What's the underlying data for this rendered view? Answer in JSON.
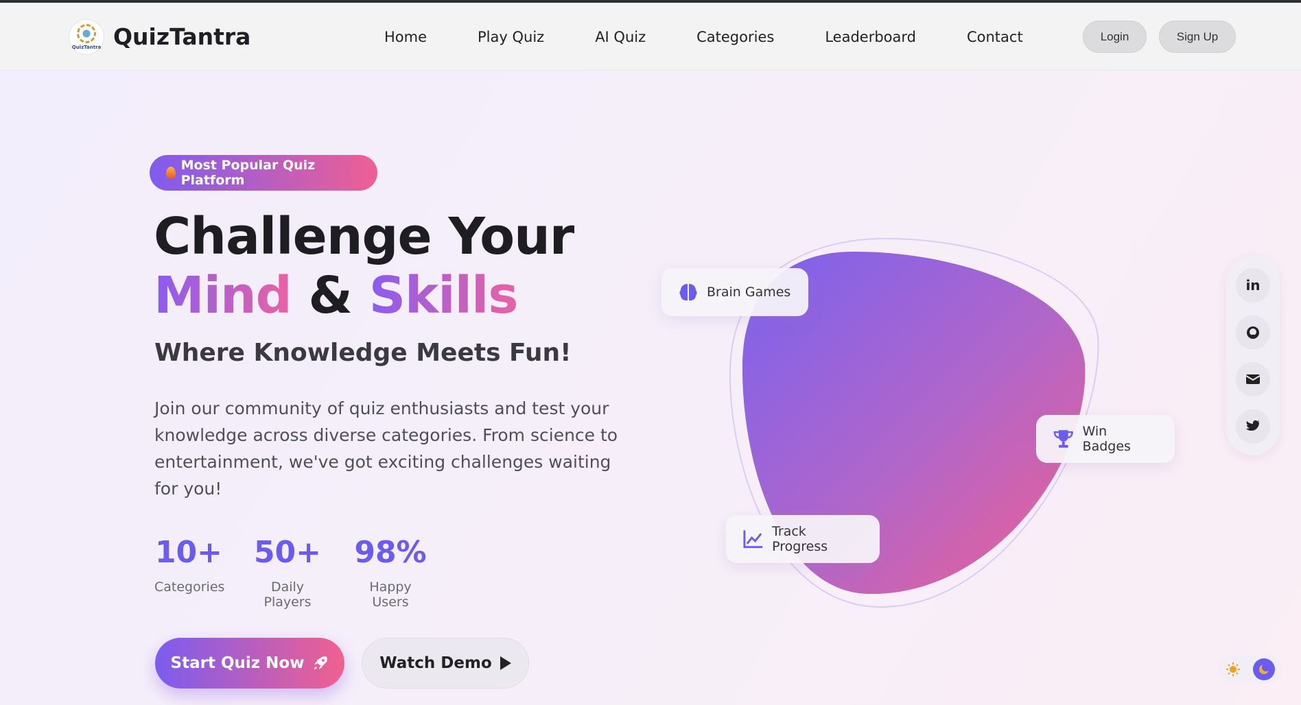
{
  "header": {
    "brand": "QuizTantra",
    "logo_text": "QuizTantra",
    "nav": [
      "Home",
      "Play Quiz",
      "AI Quiz",
      "Categories",
      "Leaderboard",
      "Contact"
    ],
    "login_label": "Login",
    "signup_label": "Sign Up"
  },
  "hero": {
    "badge": "Most Popular Quiz Platform",
    "title_line1": "Challenge Your",
    "title_word1": "Mind",
    "title_amp": "&",
    "title_word2": "Skills",
    "subtitle": "Where Knowledge Meets Fun!",
    "description": "Join our community of quiz enthusiasts and test your knowledge across diverse categories. From science to entertainment, we've got exciting challenges waiting for you!",
    "stats": [
      {
        "value": "10+",
        "label": "Categories"
      },
      {
        "value": "50+",
        "label": "Daily Players"
      },
      {
        "value": "98%",
        "label": "Happy Users"
      }
    ],
    "start_label": "Start Quiz Now",
    "demo_label": "Watch Demo"
  },
  "feature_cards": {
    "brain": "Brain Games",
    "badges": "Win Badges",
    "progress": "Track Progress"
  },
  "social": {
    "linkedin_glyph": "in"
  },
  "colors": {
    "accent_purple": "#6a5cf0",
    "accent_pink": "#f0608f"
  },
  "icons": [
    "fire-icon",
    "brain-icon",
    "trophy-icon",
    "chart-line-icon",
    "linkedin-icon",
    "github-icon",
    "envelope-icon",
    "twitter-icon",
    "rocket-icon",
    "play-icon",
    "sun-icon",
    "moon-icon"
  ]
}
